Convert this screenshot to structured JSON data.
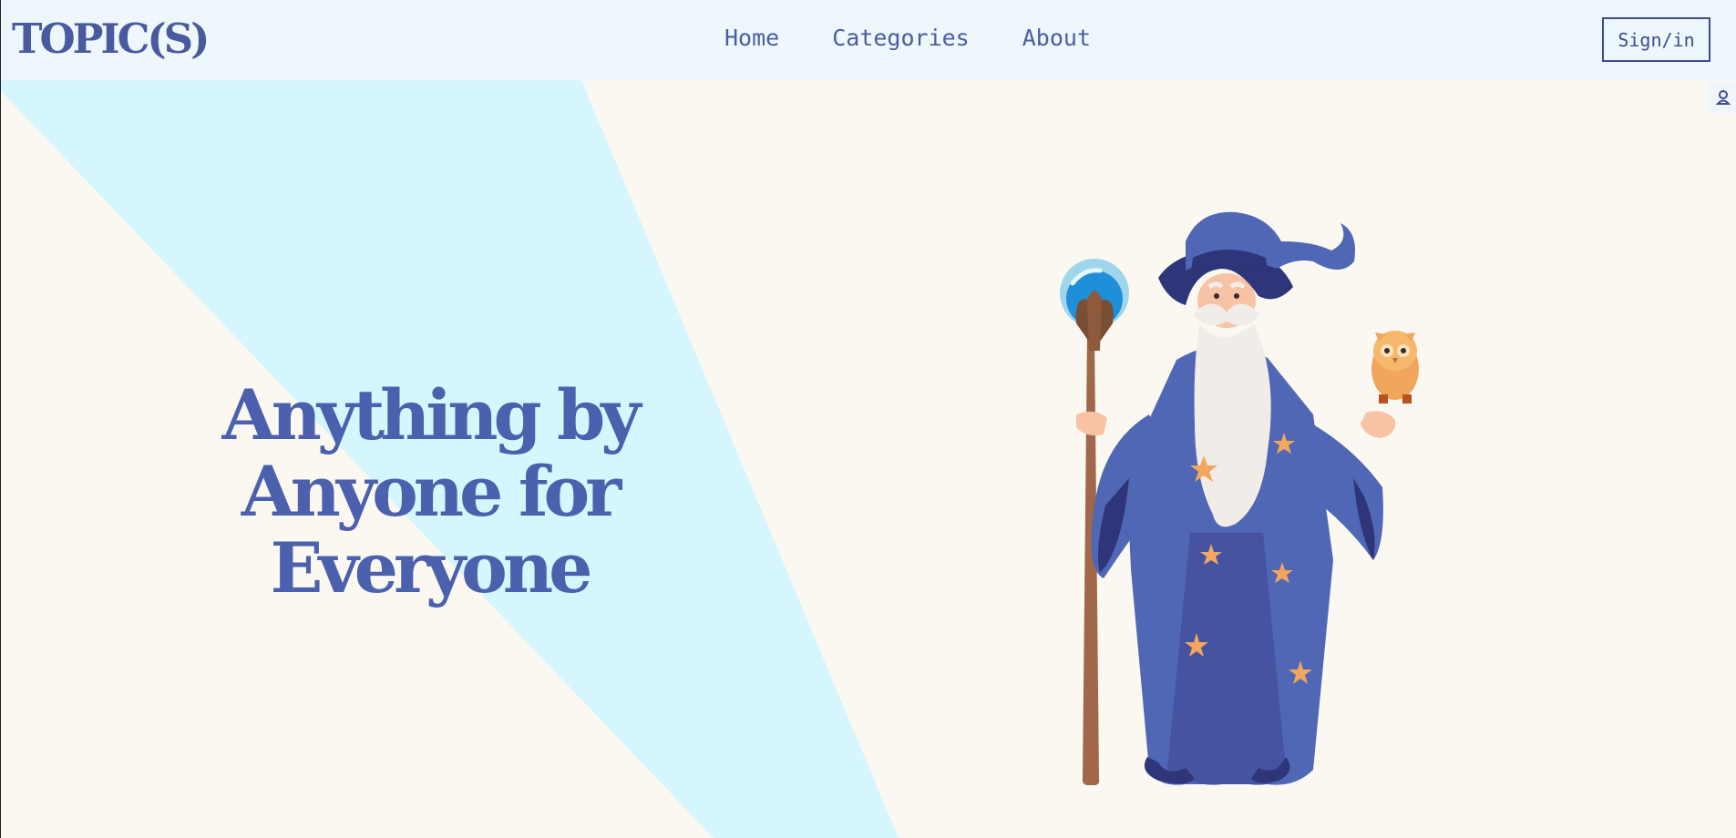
{
  "brand": {
    "logo_text": "TOPIC(S)"
  },
  "nav": {
    "links": [
      {
        "label": "Home"
      },
      {
        "label": "Categories"
      },
      {
        "label": "About"
      }
    ],
    "signin_label": "Sign/in"
  },
  "hero": {
    "headline_lines": [
      "Anything by",
      "Anyone for",
      "Everyone"
    ]
  },
  "colors": {
    "primary": "#4b61ad",
    "navbar_bg": "#eef7fb",
    "page_bg": "#fbf8f2",
    "accent_shape": "#d5f6fc"
  },
  "icons": {
    "side_tab": "user-icon",
    "illustration": "wizard-illustration"
  }
}
